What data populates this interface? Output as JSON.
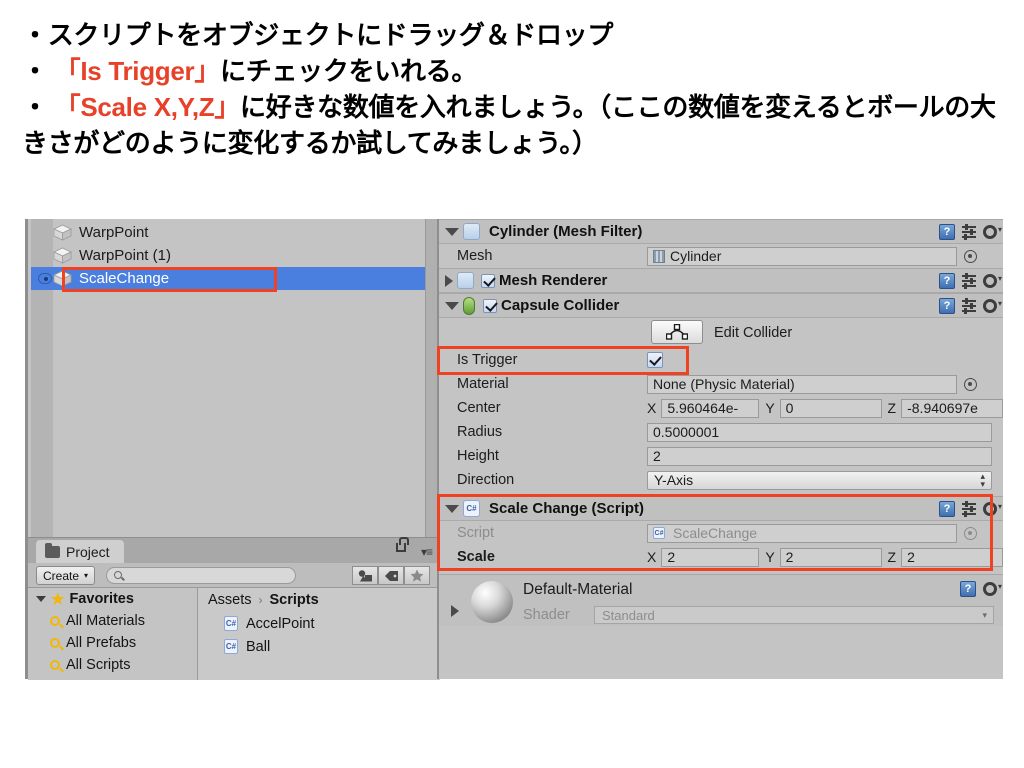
{
  "instructions": {
    "line1": "・スクリプトをオブジェクトにドラッグ＆ドロップ",
    "line2_pre": "・ ",
    "line2_accent": "「Is Trigger」",
    "line2_post": "にチェックをいれる。",
    "line3_pre": "・ ",
    "line3_accent": "「Scale X,Y,Z」",
    "line3_post": "に好きな数値を入れましょう。（ここの数値を変えるとボールの大きさがどのように変化するか試してみましょう。）",
    "accent_color": "#E8412A"
  },
  "hierarchy": {
    "items": [
      {
        "label": "WarpPoint",
        "selected": false
      },
      {
        "label": "WarpPoint (1)",
        "selected": false
      },
      {
        "label": "ScaleChange",
        "selected": true
      }
    ]
  },
  "project": {
    "tab_label": "Project",
    "create_label": "Create",
    "create_caret": "▾",
    "search_value": "",
    "menu_glyph": "▾≡",
    "favorites": {
      "label": "Favorites",
      "items": [
        "All Materials",
        "All Prefabs",
        "All Scripts"
      ]
    },
    "breadcrumb": {
      "root": "Assets",
      "separator": "›",
      "current": "Scripts"
    },
    "assets": [
      {
        "name": "AccelPoint",
        "icon": "csharp-script-icon"
      },
      {
        "name": "Ball",
        "icon": "csharp-script-icon"
      }
    ]
  },
  "inspector": {
    "mesh_filter": {
      "title": "Cylinder (Mesh Filter)",
      "mesh_label": "Mesh",
      "mesh_value": "Cylinder"
    },
    "mesh_renderer": {
      "title": "Mesh Renderer",
      "enabled": true
    },
    "capsule_collider": {
      "title": "Capsule Collider",
      "enabled": true,
      "edit_collider_label": "Edit Collider",
      "is_trigger_label": "Is Trigger",
      "is_trigger_value": true,
      "material_label": "Material",
      "material_value": "None (Physic Material)",
      "center_label": "Center",
      "center": {
        "x_axis": "X",
        "x": "5.960464e-",
        "y_axis": "Y",
        "y": "0",
        "z_axis": "Z",
        "z": "-8.940697e"
      },
      "radius_label": "Radius",
      "radius_value": "0.5000001",
      "height_label": "Height",
      "height_value": "2",
      "direction_label": "Direction",
      "direction_value": "Y-Axis"
    },
    "scale_change_script": {
      "title": "Scale Change (Script)",
      "script_label": "Script",
      "script_value": "ScaleChange",
      "scale_label": "Scale",
      "scale": {
        "x_axis": "X",
        "x": "2",
        "y_axis": "Y",
        "y": "2",
        "z_axis": "Z",
        "z": "2"
      }
    },
    "material_preview": {
      "name": "Default-Material",
      "shader_label": "Shader",
      "shader_value": "Standard"
    },
    "header_icons": {
      "help": "?",
      "preset": "preset-icon",
      "gear": "gear-icon"
    }
  },
  "highlight_color": "#EE4222"
}
